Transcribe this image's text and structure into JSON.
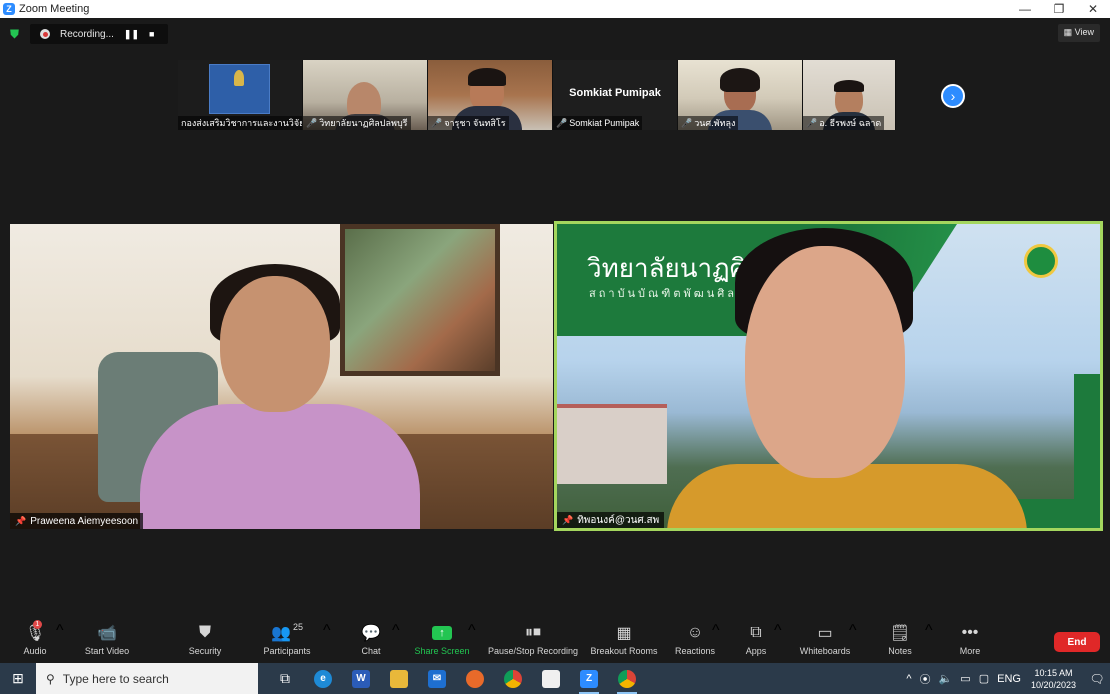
{
  "window": {
    "title": "Zoom Meeting",
    "controls": [
      "—",
      "❐",
      "✕"
    ]
  },
  "meeting": {
    "recording_label": "Recording...",
    "view_label": "View"
  },
  "thumbnails": [
    {
      "name": "กองส่งเสริมวิชาการและงานวิจัย",
      "muted": false
    },
    {
      "name": "วิทยาลัยนาฏศิลปลพบุรี",
      "muted": true
    },
    {
      "name": "จารุชา จันทสิโร",
      "muted": true
    },
    {
      "name": "Somkiat Pumipak",
      "display": "Somkiat Pumipak",
      "muted": true
    },
    {
      "name": "วนศ.พัทลุง",
      "muted": true
    },
    {
      "name": "อ. ธีรพงษ์  ฉลาด",
      "muted": true
    }
  ],
  "videos": {
    "left_name": "Praweena Aiemyeesoon",
    "right_name": "ทิพอนงค์@วนศ.สพ",
    "banner_title": "วิทยาลัยนาฏศิลป",
    "banner_subtitle": "สถาบันบัณฑิตพัฒนศิลป์"
  },
  "toolbar": {
    "audio": "Audio",
    "audio_badge": "1",
    "start_video": "Start Video",
    "security": "Security",
    "participants": "Participants",
    "participants_count": "25",
    "chat": "Chat",
    "share_screen": "Share Screen",
    "pause_recording": "Pause/Stop Recording",
    "breakout_rooms": "Breakout Rooms",
    "reactions": "Reactions",
    "apps": "Apps",
    "whiteboards": "Whiteboards",
    "notes": "Notes",
    "more": "More",
    "end": "End"
  },
  "taskbar": {
    "search_placeholder": "Type here to search",
    "language": "ENG",
    "time": "10:15 AM",
    "date": "10/20/2023"
  },
  "colors": {
    "zoom_blue": "#2d8cff",
    "share_green": "#23c552",
    "end_red": "#e02828",
    "active_speaker_border": "#a4d65e"
  }
}
